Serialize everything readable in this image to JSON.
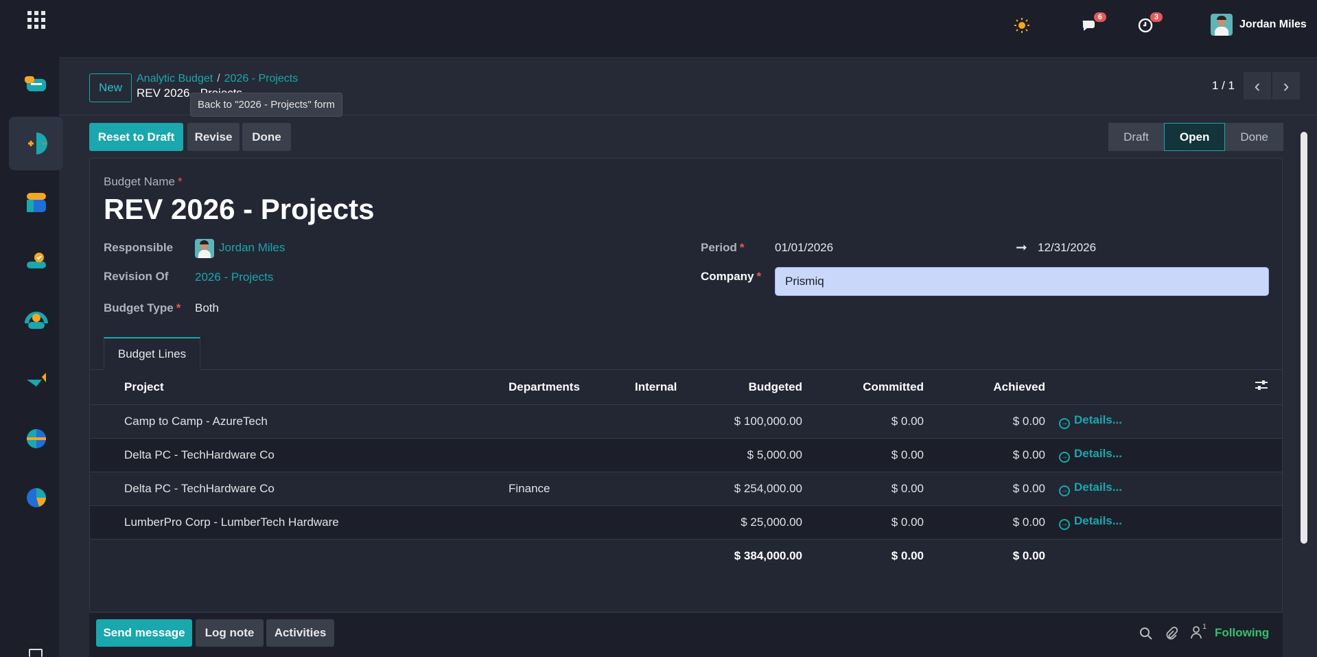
{
  "topbar": {
    "user_name": "Jordan Miles",
    "messages_count": "6",
    "activities_count": "3"
  },
  "control": {
    "new_label": "New",
    "breadcrumb_root": "Analytic Budget",
    "breadcrumb_sep": "/",
    "breadcrumb_parent": "2026 - Projects",
    "breadcrumb_current": "REV 2026 - Projects",
    "tooltip": "Back to \"2026 - Projects\" form",
    "pager": "1 / 1"
  },
  "actions": {
    "reset_label": "Reset to Draft",
    "revise_label": "Revise",
    "done_label": "Done"
  },
  "status": {
    "stages": [
      "Draft",
      "Open",
      "Done"
    ],
    "active": "Open"
  },
  "form": {
    "budget_name_label": "Budget Name",
    "budget_name": "REV 2026 - Projects",
    "responsible_label": "Responsible",
    "responsible": "Jordan Miles",
    "revision_of_label": "Revision Of",
    "revision_of": "2026 - Projects",
    "budget_type_label": "Budget Type",
    "budget_type": "Both",
    "period_label": "Period",
    "period_start": "01/01/2026",
    "period_end": "12/31/2026",
    "company_label": "Company",
    "company": "Prismiq",
    "required_mark": "*"
  },
  "tabs": {
    "budget_lines": "Budget Lines"
  },
  "table": {
    "headers": {
      "project": "Project",
      "departments": "Departments",
      "internal": "Internal",
      "budgeted": "Budgeted",
      "committed": "Committed",
      "achieved": "Achieved"
    },
    "rows": [
      {
        "project": "Camp to Camp - AzureTech",
        "departments": "",
        "internal": "",
        "budgeted": "$ 100,000.00",
        "committed": "$ 0.00",
        "achieved": "$ 0.00",
        "details": "Details..."
      },
      {
        "project": "Delta PC - TechHardware Co",
        "departments": "",
        "internal": "",
        "budgeted": "$ 5,000.00",
        "committed": "$ 0.00",
        "achieved": "$ 0.00",
        "details": "Details..."
      },
      {
        "project": "Delta PC - TechHardware Co",
        "departments": "Finance",
        "internal": "",
        "budgeted": "$ 254,000.00",
        "committed": "$ 0.00",
        "achieved": "$ 0.00",
        "details": "Details..."
      },
      {
        "project": "LumberPro Corp - LumberTech Hardware",
        "departments": "",
        "internal": "",
        "budgeted": "$ 25,000.00",
        "committed": "$ 0.00",
        "achieved": "$ 0.00",
        "details": "Details..."
      }
    ],
    "totals": {
      "budgeted": "$ 384,000.00",
      "committed": "$ 0.00",
      "achieved": "$ 0.00"
    }
  },
  "chatter": {
    "send_message": "Send message",
    "log_note": "Log note",
    "activities": "Activities",
    "followers_count": "1",
    "following": "Following"
  },
  "colors": {
    "accent": "#1aa7ad",
    "following": "#32c36c",
    "badge": "#e25a5a"
  }
}
